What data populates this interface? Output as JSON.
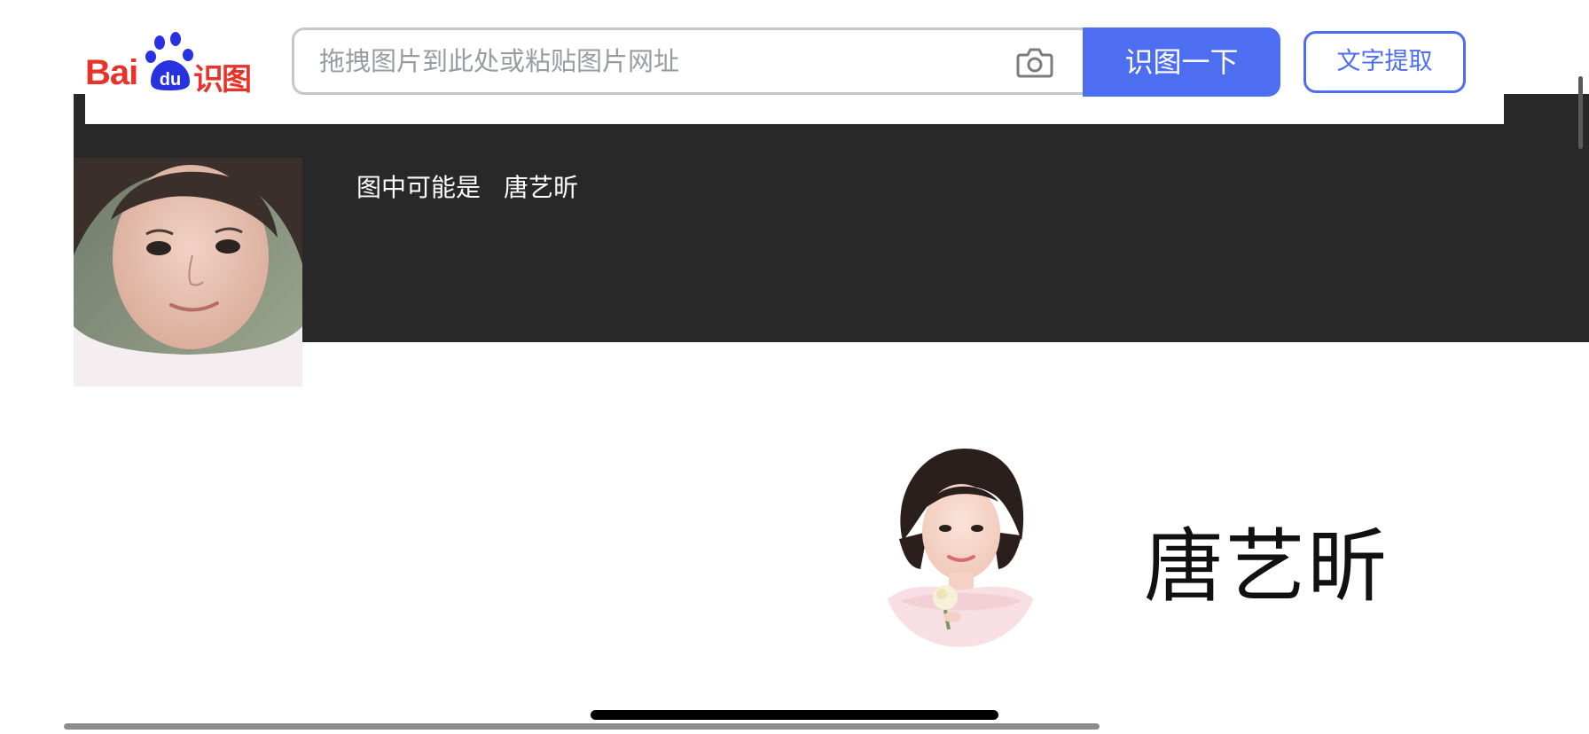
{
  "logo": {
    "brand_text": "Bai",
    "paw_text": "du",
    "product_text": "识图"
  },
  "search": {
    "placeholder": "拖拽图片到此处或粘贴图片网址",
    "value": "",
    "camera_icon": "camera-icon",
    "submit_label": "识图一下"
  },
  "text_extract": {
    "label": "文字提取"
  },
  "result": {
    "caption_prefix": "图中可能是",
    "caption_name": "唐艺昕"
  },
  "celebrity": {
    "name": "唐艺昕"
  },
  "colors": {
    "accent": "#4e6ef2",
    "brand_red": "#e8322a",
    "banner_bg": "#282828"
  }
}
